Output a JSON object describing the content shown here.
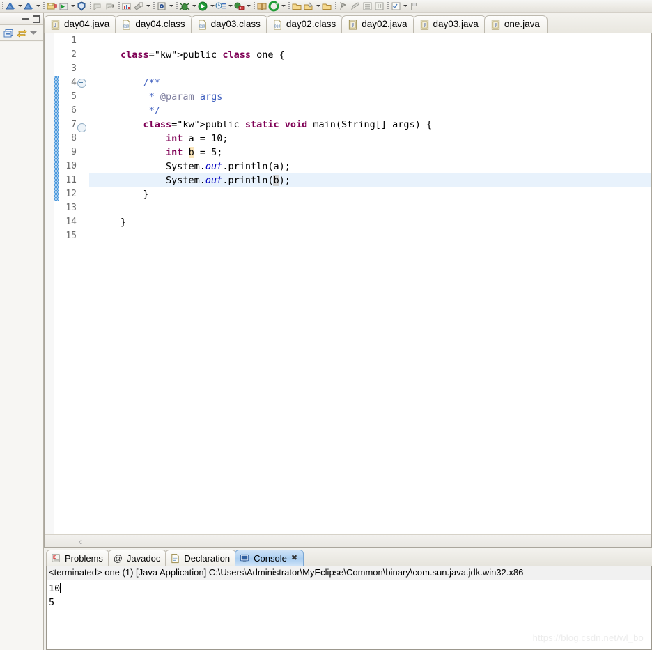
{
  "toolbar": {
    "groups": [
      {
        "items": [
          {
            "icon": "new-myeclipse-icon",
            "type": "icon"
          },
          {
            "icon": "dropdown-arrow",
            "type": "arrow"
          },
          {
            "icon": "new-wizard-icon",
            "type": "icon"
          },
          {
            "icon": "dropdown-arrow",
            "type": "arrow"
          }
        ]
      },
      {
        "items": [
          {
            "icon": "save-icon",
            "type": "icon"
          },
          {
            "icon": "run-icon",
            "type": "icon"
          },
          {
            "icon": "dropdown-arrow",
            "type": "arrow"
          },
          {
            "icon": "debug-shield-icon",
            "type": "icon"
          }
        ]
      },
      {
        "items": [
          {
            "icon": "previous-annotation-icon",
            "type": "icon"
          },
          {
            "icon": "next-annotation-icon",
            "type": "icon"
          }
        ]
      },
      {
        "items": [
          {
            "icon": "database-explorer-icon",
            "type": "icon"
          },
          {
            "icon": "open-type-icon",
            "type": "icon"
          },
          {
            "icon": "dropdown-arrow",
            "type": "arrow"
          }
        ]
      },
      {
        "items": [
          {
            "icon": "search-icon",
            "type": "icon"
          },
          {
            "icon": "dropdown-arrow",
            "type": "arrow"
          }
        ]
      },
      {
        "items": [
          {
            "icon": "debug-launch-icon",
            "type": "icon"
          },
          {
            "icon": "dropdown-arrow",
            "type": "arrow"
          },
          {
            "icon": "run-last-icon",
            "type": "icon"
          },
          {
            "icon": "dropdown-arrow",
            "type": "arrow"
          },
          {
            "icon": "history-list-icon",
            "type": "icon"
          },
          {
            "icon": "dropdown-arrow",
            "type": "arrow"
          },
          {
            "icon": "deploy-icon",
            "type": "icon"
          },
          {
            "icon": "dropdown-arrow",
            "type": "arrow"
          }
        ]
      },
      {
        "items": [
          {
            "icon": "book-help-icon",
            "type": "icon"
          },
          {
            "icon": "myeclipse-circle-icon",
            "type": "icon"
          },
          {
            "icon": "dropdown-arrow",
            "type": "arrow"
          }
        ]
      },
      {
        "items": [
          {
            "icon": "open-folder-icon",
            "type": "icon"
          },
          {
            "icon": "edit-folder-icon",
            "type": "icon"
          },
          {
            "icon": "dropdown-arrow",
            "type": "arrow"
          },
          {
            "icon": "folder-icon",
            "type": "icon"
          }
        ]
      },
      {
        "items": [
          {
            "icon": "pin-icon",
            "type": "icon"
          },
          {
            "icon": "pencil-icon",
            "type": "icon"
          },
          {
            "icon": "outline-view-icon",
            "type": "icon"
          },
          {
            "icon": "columns-view-icon",
            "type": "icon"
          }
        ]
      },
      {
        "items": [
          {
            "icon": "checklist-icon",
            "type": "icon"
          },
          {
            "icon": "dropdown-arrow",
            "type": "arrow"
          },
          {
            "icon": "flag-icon",
            "type": "icon"
          }
        ]
      }
    ]
  },
  "left_stack": {
    "minimize_label": "Minimize",
    "maximize_label": "Maximize",
    "view_icon": "package-explorer-icon",
    "link_icon": "link-with-editor-icon",
    "menu_icon": "view-menu-icon"
  },
  "editor": {
    "tabs": [
      {
        "label": "day04.java",
        "icon": "java-file-icon",
        "active": false
      },
      {
        "label": "day04.class",
        "icon": "class-file-icon",
        "active": false
      },
      {
        "label": "day03.class",
        "icon": "class-file-icon",
        "active": false
      },
      {
        "label": "day02.class",
        "icon": "class-file-icon",
        "active": false
      },
      {
        "label": "day02.java",
        "icon": "java-file-icon",
        "active": false
      },
      {
        "label": "day03.java",
        "icon": "java-file-icon",
        "active": false
      },
      {
        "label": "one.java",
        "icon": "java-file-icon",
        "active": true
      }
    ],
    "line_numbers": [
      "1",
      "2",
      "3",
      "4",
      "5",
      "6",
      "7",
      "8",
      "9",
      "10",
      "11",
      "12",
      "13",
      "14",
      "15"
    ],
    "fold_lines": [
      4,
      7
    ],
    "current_line": 11,
    "changed_line_start": 4,
    "changed_line_end": 12,
    "code_lines": [
      {
        "n": 1,
        "text": ""
      },
      {
        "n": 2,
        "text": "public class one {"
      },
      {
        "n": 3,
        "text": ""
      },
      {
        "n": 4,
        "text": "    /**"
      },
      {
        "n": 5,
        "text": "     * @param args"
      },
      {
        "n": 6,
        "text": "     */"
      },
      {
        "n": 7,
        "text": "    public static void main(String[] args) {"
      },
      {
        "n": 8,
        "text": "        int a = 10;"
      },
      {
        "n": 9,
        "text": "        int b = 5;"
      },
      {
        "n": 10,
        "text": "        System.out.println(a);"
      },
      {
        "n": 11,
        "text": "        System.out.println(b);"
      },
      {
        "n": 12,
        "text": "    }"
      },
      {
        "n": 13,
        "text": ""
      },
      {
        "n": 14,
        "text": "}"
      },
      {
        "n": 15,
        "text": ""
      }
    ],
    "scroll_left_arrow": "‹"
  },
  "bottom_panel": {
    "tabs": [
      {
        "label": "Problems",
        "icon": "problems-icon",
        "active": false,
        "closable": false
      },
      {
        "label": "Javadoc",
        "icon": "javadoc-at-icon",
        "active": false,
        "closable": false
      },
      {
        "label": "Declaration",
        "icon": "declaration-icon",
        "active": false,
        "closable": false
      },
      {
        "label": "Console",
        "icon": "console-icon",
        "active": true,
        "closable": true
      }
    ],
    "close_glyph": "✖",
    "console": {
      "header": "<terminated> one (1) [Java Application] C:\\Users\\Administrator\\MyEclipse\\Common\\binary\\com.sun.java.jdk.win32.x86",
      "output_lines": [
        "10",
        "5"
      ]
    }
  },
  "watermark": {
    "text": "https://blog.csdn.net/wl_bo"
  },
  "colors": {
    "keyword": "#7F0055",
    "comment": "#3F5FBF",
    "javadoc_tag": "#7F7F9F",
    "static_field": "#0000C0",
    "current_line_bg": "#E8F2FC",
    "occurrence_bg": "#D4D4D4",
    "write_occurrence_bg": "#FBE6BB",
    "change_bar": "#1F7FD4",
    "active_tab_bg": "#A9CDF0"
  }
}
